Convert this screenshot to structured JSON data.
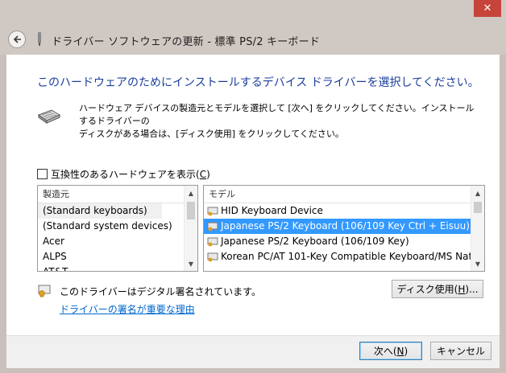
{
  "window": {
    "title": "ドライバー ソフトウェアの更新 - 標準 PS/2 キーボード",
    "close_glyph": "✕",
    "back_icon": "back-arrow-icon"
  },
  "main": {
    "heading": "このハードウェアのためにインストールするデバイス ドライバーを選択してください。",
    "description_line1": "ハードウェア デバイスの製造元とモデルを選択して [次へ] をクリックしてください。インストールするドライバーの",
    "description_line2": "ディスクがある場合は、[ディスク使用] をクリックしてください。",
    "compat_label_main": "互換性のあるハードウェアを表示(",
    "compat_label_key": "C",
    "compat_label_end": ")",
    "compat_checked": false
  },
  "manufacturers": {
    "header": "製造元",
    "items": [
      "(Standard keyboards)",
      "(Standard system devices)",
      "Acer",
      "ALPS",
      "AT&T"
    ],
    "selected_index": 0
  },
  "models": {
    "header": "モデル",
    "items": [
      "HID Keyboard Device",
      "Japanese PS/2 Keyboard (106/109 Key Ctrl + Eisuu)",
      "Japanese PS/2 Keyboard (106/109 Key)",
      "Korean PC/AT 101-Key Compatible Keyboard/MS Nat"
    ],
    "selected_index": 1
  },
  "signature": {
    "text": "このドライバーはデジタル署名されています。",
    "link": "ドライバーの署名が重要な理由"
  },
  "buttons": {
    "disk_main": "ディスク使用(",
    "disk_key": "H",
    "disk_end": ")...",
    "next_main": "次へ(",
    "next_key": "N",
    "next_end": ")",
    "cancel": "キャンセル"
  },
  "colors": {
    "heading": "#1a3e9a",
    "selection": "#3399ff",
    "link": "#0066cc",
    "close": "#c7443a"
  }
}
